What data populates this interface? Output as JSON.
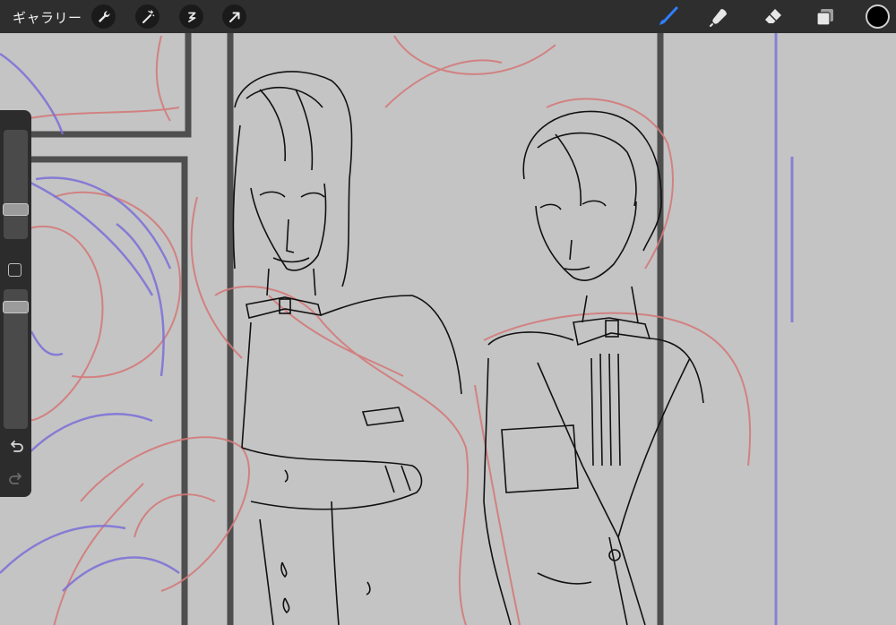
{
  "app": {
    "gallery_label": "ギャラリー",
    "actions": [
      {
        "name": "wrench-icon"
      },
      {
        "name": "magic-wand-icon"
      },
      {
        "name": "selection-icon"
      },
      {
        "name": "transform-arrow-icon"
      }
    ],
    "tools": [
      {
        "name": "brush-icon",
        "active": true,
        "color": "#2f7fff"
      },
      {
        "name": "smudge-icon",
        "active": false
      },
      {
        "name": "eraser-icon",
        "active": false
      },
      {
        "name": "layers-icon",
        "active": false
      }
    ],
    "current_color": "#000000"
  },
  "sidebar": {
    "brush_size_slider": {
      "level": 0.7
    },
    "opacity_slider": {
      "level": 0.03
    },
    "modify_button": "square",
    "undo_icon": "undo-icon",
    "redo_icon": "redo-icon"
  },
  "canvas": {
    "background": "#c4c4c4",
    "sketch_colors": {
      "line": "#111111",
      "red_sketch": "#d47a7a",
      "blue_sketch": "#7b6fd8",
      "panel_border": "#3a3a3a"
    }
  }
}
